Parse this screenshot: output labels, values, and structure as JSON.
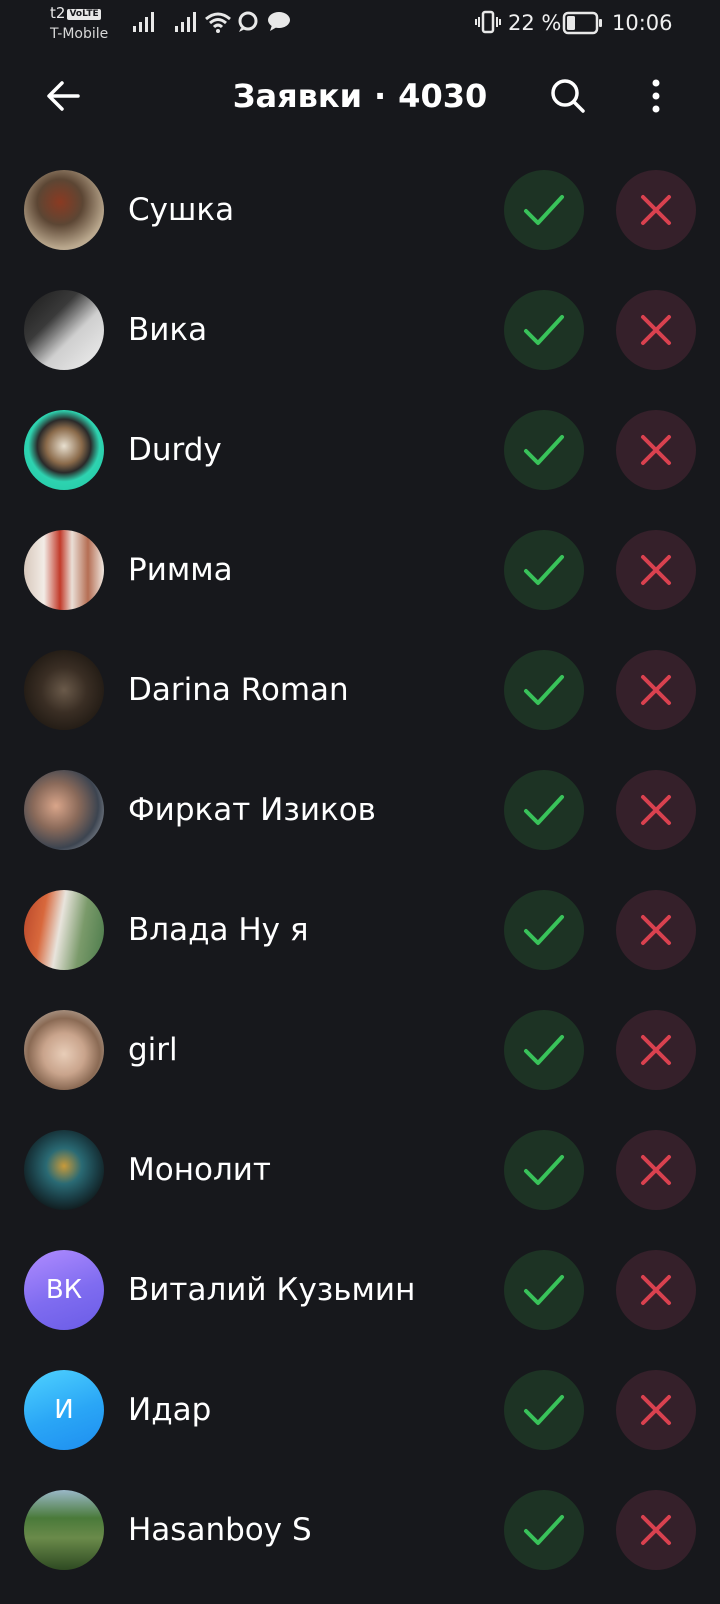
{
  "status_bar": {
    "carrier_top": "t2",
    "volte": "VoLTE",
    "carrier_name": "T-Mobile",
    "battery_percent": "22 %",
    "time": "10:06"
  },
  "header": {
    "title": "Заявки",
    "separator": "·",
    "count": "4030"
  },
  "colors": {
    "background": "#17181c",
    "accept_bg": "#1d3324",
    "accept_icon": "#39c25a",
    "decline_bg": "#35202a",
    "decline_icon": "#d9414f"
  },
  "requests": [
    {
      "name": "Сушка",
      "avatar": "photo-avatar"
    },
    {
      "name": "Вика",
      "avatar": "photo-avatar"
    },
    {
      "name": "Durdy",
      "avatar": "photo-avatar"
    },
    {
      "name": "Римма",
      "avatar": "photo-avatar"
    },
    {
      "name": "Darina Roman",
      "avatar": "photo-avatar"
    },
    {
      "name": "Фиркат Изиков",
      "avatar": "photo-avatar"
    },
    {
      "name": "Влада Ну я",
      "avatar": "photo-avatar"
    },
    {
      "name": "girl",
      "avatar": "photo-avatar"
    },
    {
      "name": "Монолит",
      "avatar": "photo-avatar"
    },
    {
      "name": "Виталий Кузьмин",
      "avatar": "initials-avatar",
      "initials": "ВК"
    },
    {
      "name": "Идар",
      "avatar": "initials-avatar",
      "initials": "И"
    },
    {
      "name": "Hasanboy S",
      "avatar": "photo-avatar"
    }
  ]
}
